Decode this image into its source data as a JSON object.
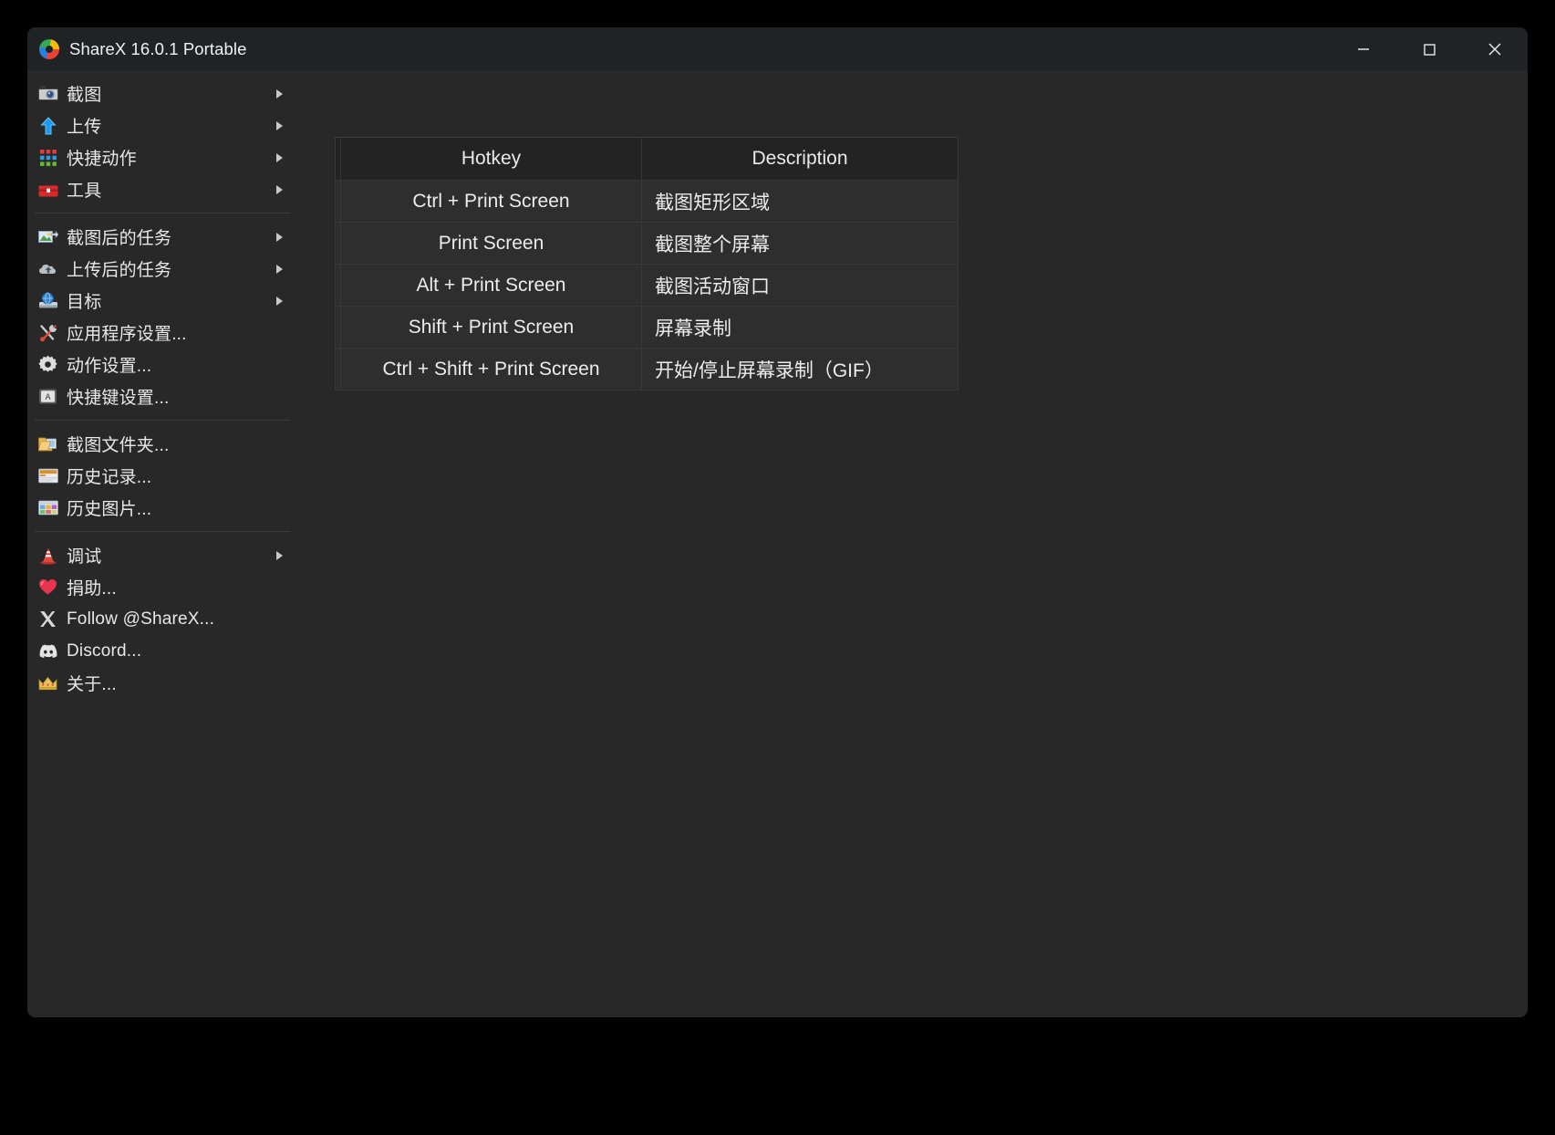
{
  "window": {
    "title": "ShareX 16.0.1 Portable",
    "logo_icon": "sharex-logo-icon",
    "controls": {
      "minimize": "minimize-icon",
      "maximize": "maximize-icon",
      "close": "close-icon"
    },
    "background_color": "#282828",
    "titlebar_color": "#202326"
  },
  "sidebar": {
    "groups": [
      {
        "items": [
          {
            "label": "截图",
            "icon": "camera-icon",
            "has_submenu": true
          },
          {
            "label": "上传",
            "icon": "upload-arrow-icon",
            "has_submenu": true
          },
          {
            "label": "快捷动作",
            "icon": "grid-dots-icon",
            "has_submenu": true
          },
          {
            "label": "工具",
            "icon": "toolbox-icon",
            "has_submenu": true
          }
        ]
      },
      {
        "items": [
          {
            "label": "截图后的任务",
            "icon": "after-capture-icon",
            "has_submenu": true
          },
          {
            "label": "上传后的任务",
            "icon": "after-upload-icon",
            "has_submenu": true
          },
          {
            "label": "目标",
            "icon": "destination-icon",
            "has_submenu": true
          },
          {
            "label": "应用程序设置...",
            "icon": "wrench-screwdriver-icon",
            "has_submenu": false
          },
          {
            "label": "动作设置...",
            "icon": "gear-icon",
            "has_submenu": false
          },
          {
            "label": "快捷键设置...",
            "icon": "keyboard-key-icon",
            "has_submenu": false
          }
        ]
      },
      {
        "items": [
          {
            "label": "截图文件夹...",
            "icon": "folder-icon",
            "has_submenu": false
          },
          {
            "label": "历史记录...",
            "icon": "history-list-icon",
            "has_submenu": false
          },
          {
            "label": "历史图片...",
            "icon": "image-history-icon",
            "has_submenu": false
          }
        ]
      },
      {
        "items": [
          {
            "label": "调试",
            "icon": "traffic-cone-icon",
            "has_submenu": true
          },
          {
            "label": "捐助...",
            "icon": "heart-icon",
            "has_submenu": false
          },
          {
            "label": "Follow @ShareX...",
            "icon": "x-twitter-icon",
            "has_submenu": false
          },
          {
            "label": "Discord...",
            "icon": "discord-icon",
            "has_submenu": false
          },
          {
            "label": "关于...",
            "icon": "crown-icon",
            "has_submenu": false
          }
        ]
      }
    ]
  },
  "hotkey_table": {
    "headers": {
      "hotkey": "Hotkey",
      "description": "Description"
    },
    "status_color": "#5aa45a",
    "rows": [
      {
        "hotkey": "Ctrl + Print Screen",
        "description": "截图矩形区域"
      },
      {
        "hotkey": "Print Screen",
        "description": "截图整个屏幕"
      },
      {
        "hotkey": "Alt + Print Screen",
        "description": "截图活动窗口"
      },
      {
        "hotkey": "Shift + Print Screen",
        "description": "屏幕录制"
      },
      {
        "hotkey": "Ctrl + Shift + Print Screen",
        "description": "开始/停止屏幕录制（GIF）"
      }
    ]
  }
}
